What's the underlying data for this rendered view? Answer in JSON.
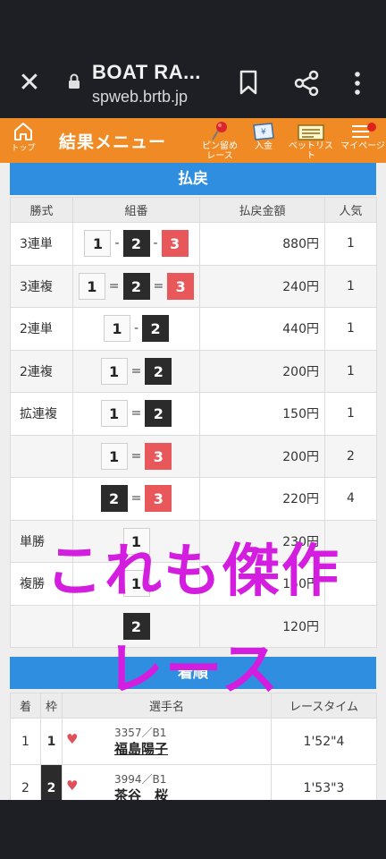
{
  "browser": {
    "title": "BOAT RA...",
    "host": "spweb.brtb.jp"
  },
  "nav": {
    "home_label": "トップ",
    "title": "結果メニュー",
    "items": [
      {
        "label": "ピン留め\nレース",
        "icon": "pin-icon"
      },
      {
        "label": "入金",
        "icon": "deposit-icon"
      },
      {
        "label": "ベットリスト",
        "icon": "betlist-icon"
      },
      {
        "label": "マイページ",
        "icon": "menu-icon"
      }
    ]
  },
  "payout": {
    "heading": "払戻",
    "columns": [
      "勝式",
      "組番",
      "払戻金額",
      "人気"
    ],
    "rows": [
      {
        "kind": "3連単",
        "boats": [
          "1",
          "2",
          "3"
        ],
        "sep": "-",
        "amount": "880円",
        "pop": "1"
      },
      {
        "kind": "3連複",
        "boats": [
          "1",
          "2",
          "3"
        ],
        "sep": "=",
        "amount": "240円",
        "pop": "1"
      },
      {
        "kind": "2連単",
        "boats": [
          "1",
          "2"
        ],
        "sep": "-",
        "amount": "440円",
        "pop": "1"
      },
      {
        "kind": "2連複",
        "boats": [
          "1",
          "2"
        ],
        "sep": "=",
        "amount": "200円",
        "pop": "1"
      },
      {
        "kind": "拡連複",
        "boats": [
          "1",
          "2"
        ],
        "sep": "=",
        "amount": "150円",
        "pop": "1"
      },
      {
        "kind": "",
        "boats": [
          "1",
          "3"
        ],
        "sep": "=",
        "amount": "200円",
        "pop": "2"
      },
      {
        "kind": "",
        "boats": [
          "2",
          "3"
        ],
        "sep": "=",
        "amount": "220円",
        "pop": "4"
      },
      {
        "kind": "単勝",
        "boats": [
          "1"
        ],
        "sep": "",
        "amount": "230円",
        "pop": ""
      },
      {
        "kind": "複勝",
        "boats": [
          "1"
        ],
        "sep": "",
        "amount": "150円",
        "pop": ""
      },
      {
        "kind": "",
        "boats": [
          "2"
        ],
        "sep": "",
        "amount": "120円",
        "pop": ""
      }
    ]
  },
  "result": {
    "heading": "着順",
    "columns": [
      "着",
      "枠",
      "選手名",
      "レースタイム"
    ],
    "rows": [
      {
        "pos": "1",
        "frame": "1",
        "reg": "3357／B1",
        "name": "福島陽子",
        "time": "1'52\"4"
      },
      {
        "pos": "2",
        "frame": "2",
        "reg": "3994／B1",
        "name": "茶谷　桜",
        "time": "1'53\"3"
      }
    ]
  },
  "overlay": {
    "line1": "これも傑作",
    "line2": "レース"
  },
  "colors": {
    "nav_orange": "#f08a24",
    "section_blue": "#2f8ee0",
    "boat1": "#fafafa",
    "boat2": "#2b2b2b",
    "boat3": "#e8575a",
    "overlay_magenta": "#d31ee0"
  }
}
